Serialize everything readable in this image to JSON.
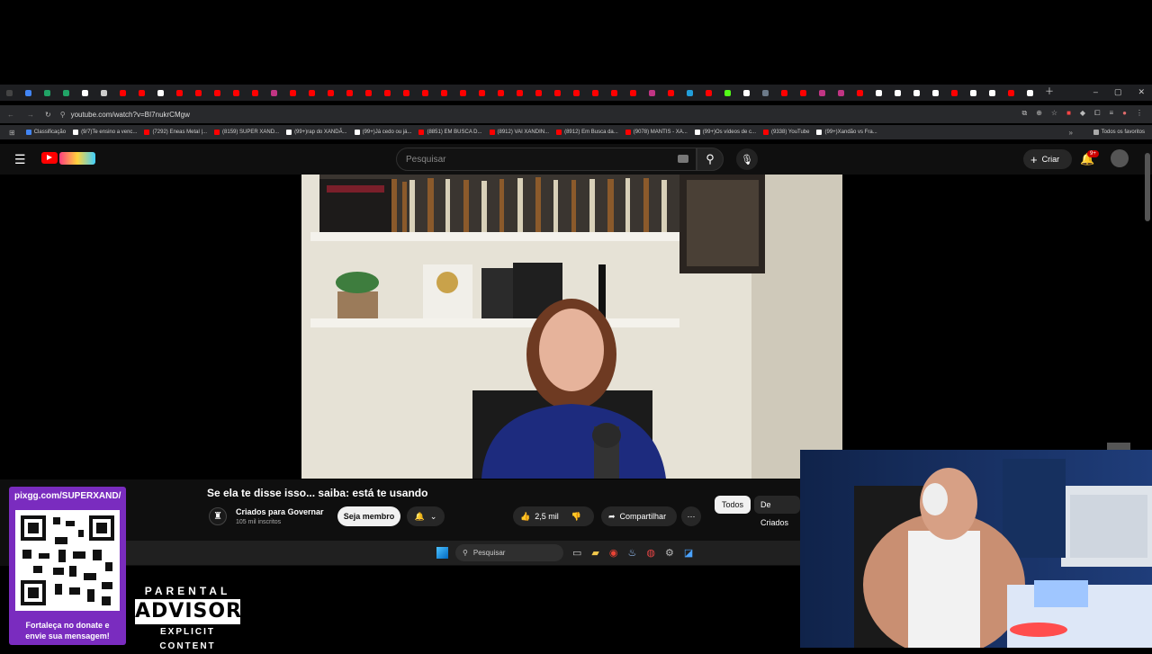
{
  "browser": {
    "tab_colors": [
      "#444",
      "#4285f4",
      "#21a366",
      "#21a366",
      "#fff",
      "#ccc",
      "#ff0000",
      "#ff0000",
      "#fff",
      "#ff0000",
      "#ff0000",
      "#ff0000",
      "#ff0000",
      "#ff0000",
      "#c13584",
      "#ff0000",
      "#ff0000",
      "#ff0000",
      "#ff0000",
      "#ff0000",
      "#ff0000",
      "#ff0000",
      "#ff0000",
      "#ff0000",
      "#ff0000",
      "#ff0000",
      "#ff0000",
      "#ff0000",
      "#ff0000",
      "#ff0000",
      "#ff0000",
      "#ff0000",
      "#ff0000",
      "#ff0000",
      "#c13584",
      "#ff0000",
      "#229ed9",
      "#ff0000",
      "#53fc18",
      "#fff",
      "#6c7a89",
      "#ff0000",
      "#ff0000",
      "#c13584",
      "#c13584",
      "#ff0000",
      "#fff",
      "#fff",
      "#fff",
      "#fff",
      "#ff0000",
      "#fff",
      "#fff",
      "#ff0000",
      "#fff"
    ],
    "url": "youtube.com/watch?v=BI7nukrCMgw",
    "bookmarks": [
      {
        "label": "Classificação",
        "color": "#4285f4"
      },
      {
        "label": "(9/7)Te ensino a venc...",
        "color": "#fff"
      },
      {
        "label": "(7292) Eneas Metal |...",
        "color": "#ff0000"
      },
      {
        "label": "(8159) SUPER XAND...",
        "color": "#ff0000"
      },
      {
        "label": "(99+)rap do XANDÃ...",
        "color": "#fff"
      },
      {
        "label": "(99+)Já cedo ou já...",
        "color": "#fff"
      },
      {
        "label": "(8851) EM BUSCA D...",
        "color": "#ff0000"
      },
      {
        "label": "(8912) VAI XANDIN...",
        "color": "#ff0000"
      },
      {
        "label": "(8912) Em Busca da...",
        "color": "#ff0000"
      },
      {
        "label": "(9078) MANTIS - XA...",
        "color": "#ff0000"
      },
      {
        "label": "(99+)Os vídeos de c...",
        "color": "#fff"
      },
      {
        "label": "(9338) YouTube",
        "color": "#ff0000"
      },
      {
        "label": "(99+)Xandão vs Fra...",
        "color": "#fff"
      }
    ],
    "all_favorites": "Todos os favoritos"
  },
  "youtube": {
    "search_placeholder": "Pesquisar",
    "create_label": "Criar",
    "notif_badge": "9+"
  },
  "video": {
    "title": "Se ela te disse isso... saiba: está te usando",
    "channel": "Criados para Governar",
    "subscribers": "105 mil inscritos",
    "member_button": "Seja membro",
    "likes": "2,5 mil",
    "share": "Compartilhar",
    "filter_all": "Todos",
    "filter_creator": "De Criados"
  },
  "taskbar": {
    "search": "Pesquisar"
  },
  "overlay": {
    "donate_url": "pixgg.com/SUPERXAND/",
    "donate_text": "Fortaleça no donate e envie sua mensagem!",
    "advisory_top": "PARENTAL",
    "advisory_mid": "ADVISORY",
    "advisory_bottom": "EXPLICIT CONTENT"
  }
}
